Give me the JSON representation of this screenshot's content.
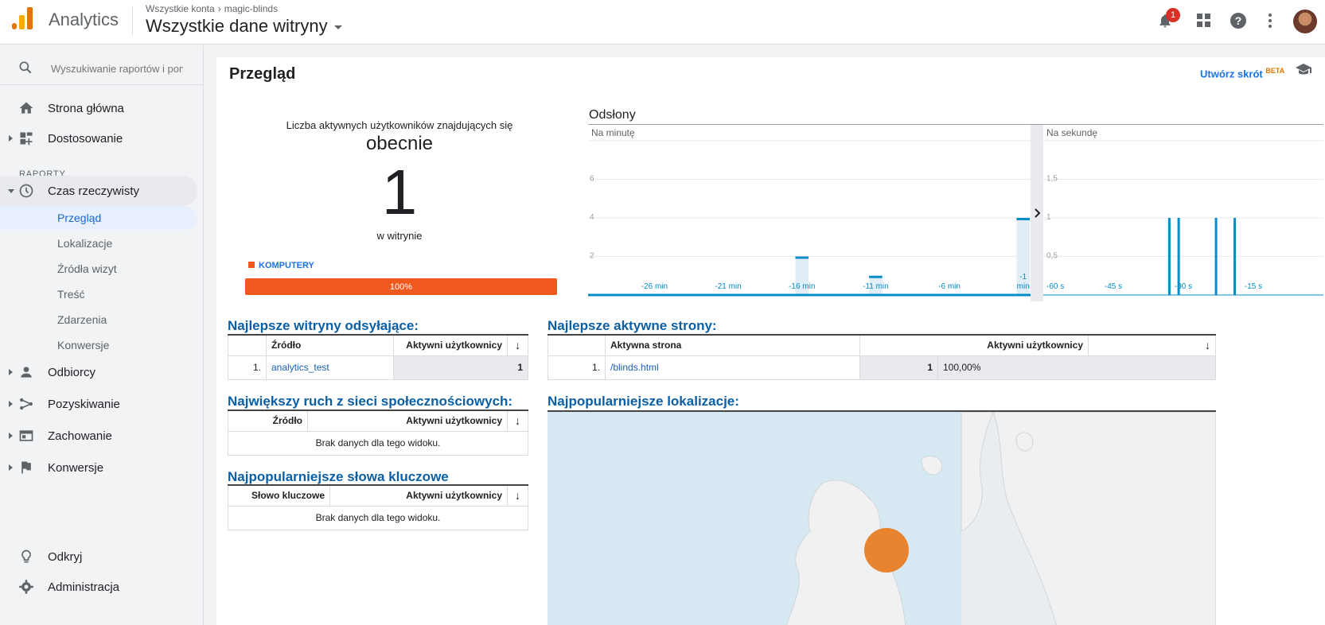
{
  "header": {
    "app_name": "Analytics",
    "breadcrumb_account": "Wszystkie konta",
    "breadcrumb_property": "magic-blinds",
    "view_name": "Wszystkie dane witryny",
    "notification_count": "1"
  },
  "sidebar": {
    "search_placeholder": "Wyszukiwanie raportów i pom",
    "home": "Strona główna",
    "customize": "Dostosowanie",
    "section_reports": "RAPORTY",
    "realtime": "Czas rzeczywisty",
    "realtime_items": [
      "Przegląd",
      "Lokalizacje",
      "Źródła wizyt",
      "Treść",
      "Zdarzenia",
      "Konwersje"
    ],
    "audience": "Odbiorcy",
    "acquisition": "Pozyskiwanie",
    "behavior": "Zachowanie",
    "conversions": "Konwersje",
    "discover": "Odkryj",
    "admin": "Administracja"
  },
  "main": {
    "title": "Przegląd",
    "shortcut_label": "Utwórz skrót",
    "shortcut_badge": "BETA",
    "active_users_line1": "Liczba aktywnych użytkowników znajdujących się",
    "active_users_line2": "obecnie",
    "active_users_count": "1",
    "active_users_line3": "w witrynie",
    "device_label": "KOMPUTERY",
    "device_percent": "100%",
    "device_share": 1.0
  },
  "chart_data": {
    "type": "bar",
    "title": "Odsłony",
    "panels": [
      {
        "subtitle": "Na minutę",
        "x_tick_labels": [
          "-26 min",
          "-21 min",
          "-16 min",
          "-11 min",
          "-6 min",
          "-1 min"
        ],
        "y_tick_labels": [
          "2",
          "4",
          "6"
        ],
        "ylim": [
          0,
          8
        ],
        "categories": [
          -30,
          -29,
          -28,
          -27,
          -26,
          -25,
          -24,
          -23,
          -22,
          -21,
          -20,
          -19,
          -18,
          -17,
          -16,
          -15,
          -14,
          -13,
          -12,
          -11,
          -10,
          -9,
          -8,
          -7,
          -6,
          -5,
          -4,
          -3,
          -2,
          -1
        ],
        "values": [
          0,
          0,
          0,
          0,
          0,
          0,
          0,
          0,
          0,
          0,
          0,
          0,
          0,
          0,
          2,
          0,
          0,
          0,
          0,
          1,
          0,
          0,
          0,
          0,
          0,
          0,
          0,
          0,
          0,
          4
        ]
      },
      {
        "subtitle": "Na sekundę",
        "x_tick_labels": [
          "-60 s",
          "-45 s",
          "-30 s",
          "-15 s"
        ],
        "y_tick_labels": [
          "0,5",
          "1",
          "1,5"
        ],
        "ylim": [
          0,
          2
        ],
        "spike_seconds": [
          -33,
          -31,
          -23,
          -19
        ],
        "values": [
          1,
          1,
          1,
          1
        ]
      }
    ]
  },
  "referrals": {
    "title": "Najlepsze witryny odsyłające:",
    "col_source": "Źródło",
    "col_users": "Aktywni użytkownicy",
    "rows": [
      {
        "index": "1.",
        "source": "analytics_test",
        "users": "1"
      }
    ]
  },
  "social": {
    "title": "Największy ruch z sieci społecznościowych:",
    "col_source": "Źródło",
    "col_users": "Aktywni użytkownicy",
    "empty": "Brak danych dla tego widoku."
  },
  "keywords": {
    "title": "Najpopularniejsze słowa kluczowe",
    "col_keyword": "Słowo kluczowe",
    "col_users": "Aktywni użytkownicy",
    "empty": "Brak danych dla tego widoku."
  },
  "pages": {
    "title": "Najlepsze aktywne strony:",
    "col_page": "Aktywna strona",
    "col_users": "Aktywni użytkownicy",
    "rows": [
      {
        "index": "1.",
        "page": "/blinds.html",
        "users": "1",
        "percent": "100,00%"
      }
    ]
  },
  "locations": {
    "title": "Najpopularniejsze lokalizacje:"
  },
  "colors": {
    "accent_orange": "#f0591e",
    "chart_blue": "#058dc7",
    "map_marker": "#e8832f"
  }
}
